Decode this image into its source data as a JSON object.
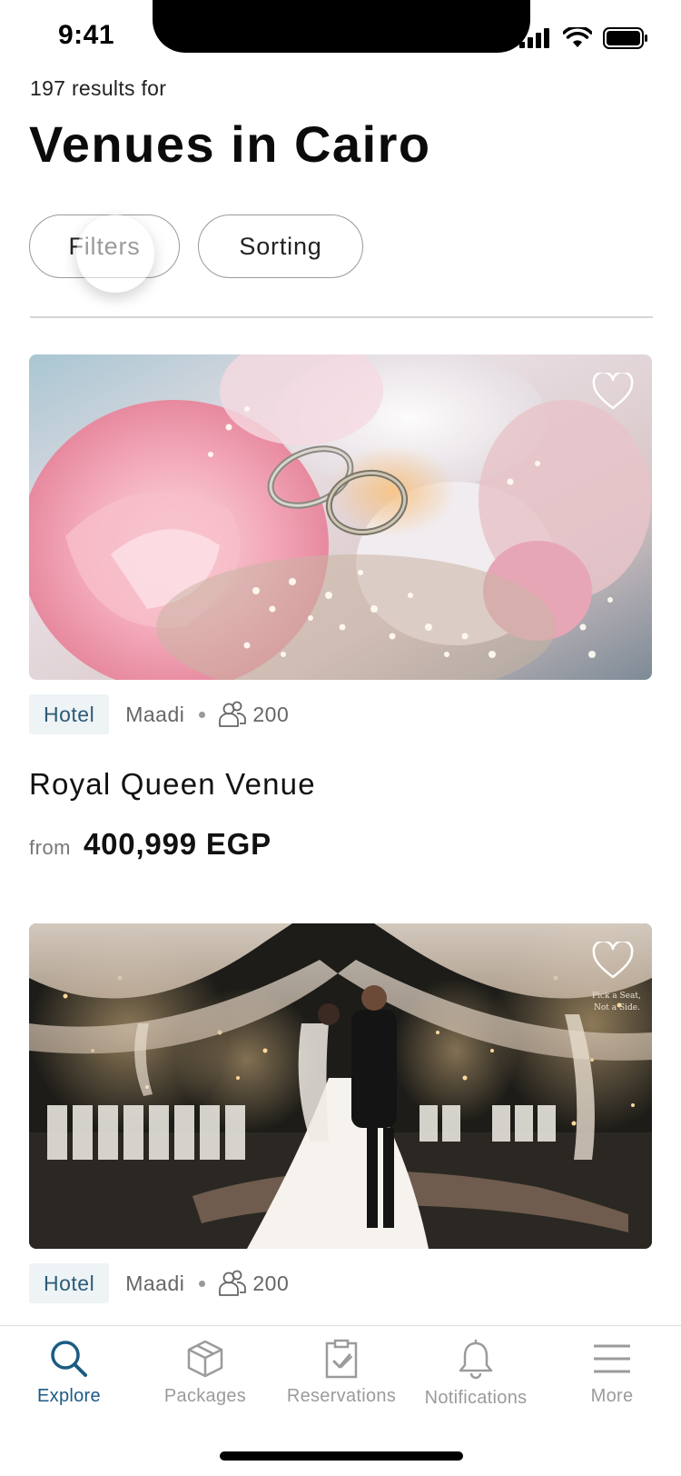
{
  "status_bar": {
    "time": "9:41"
  },
  "header": {
    "results_count": "197 results for",
    "title": "Venues in Cairo",
    "filters_label": "Filters",
    "sorting_label": "Sorting"
  },
  "venues": [
    {
      "type": "Hotel",
      "area": "Maadi",
      "capacity": "200",
      "name": "Royal Queen Venue",
      "price_prefix": "from",
      "price": "400,999 EGP",
      "image": "wedding-rings-on-flowers"
    },
    {
      "type": "Hotel",
      "area": "Maadi",
      "capacity": "200",
      "image": "bride-and-groom-outdoor-venue"
    }
  ],
  "tab_bar": {
    "tabs": [
      {
        "label": "Explore",
        "icon": "search-icon",
        "active": true
      },
      {
        "label": "Packages",
        "icon": "package-box-icon",
        "active": false
      },
      {
        "label": "Reservations",
        "icon": "clipboard-check-icon",
        "active": false
      },
      {
        "label": "Notifications",
        "icon": "bell-icon",
        "active": false
      },
      {
        "label": "More",
        "icon": "menu-icon",
        "active": false
      }
    ]
  },
  "colors": {
    "accent": "#1b5b83",
    "tag_background": "#eef3f5",
    "inactive_tab": "#9b9b9b"
  }
}
